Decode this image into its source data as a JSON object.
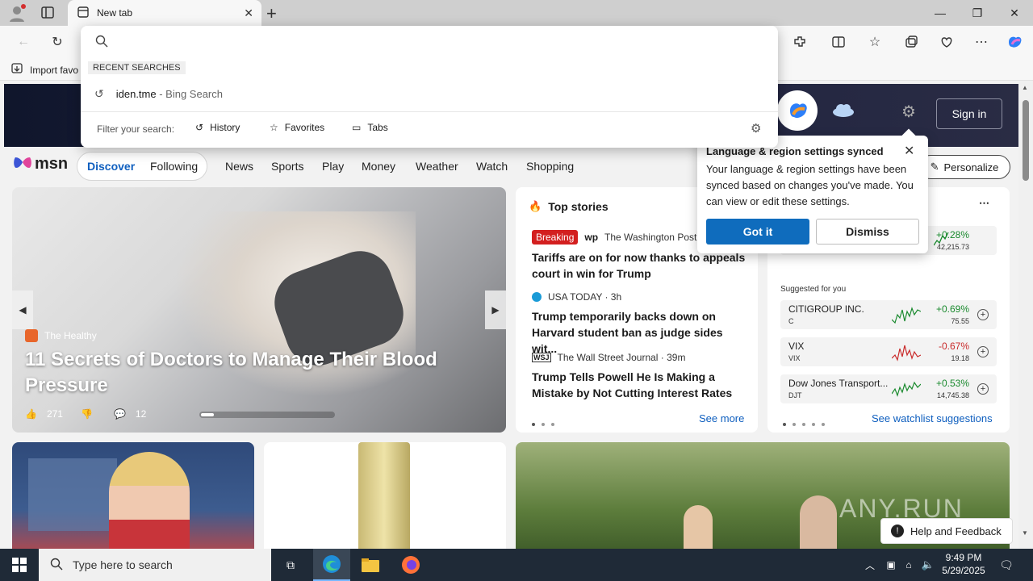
{
  "browser": {
    "tab_title": "New tab",
    "favorites_bar": {
      "import_label": "Import favo"
    }
  },
  "address_dropdown": {
    "input_value": "",
    "recent_heading": "RECENT SEARCHES",
    "recent": [
      {
        "query": "iden.tme",
        "suffix": "- Bing Search"
      }
    ],
    "filter_label": "Filter your search:",
    "filters": [
      "History",
      "Favorites",
      "Tabs"
    ]
  },
  "msn": {
    "logo": "msn",
    "sign_in": "Sign in",
    "nav": {
      "discover": "Discover",
      "following": "Following",
      "items": [
        "News",
        "Sports",
        "Play",
        "Money",
        "Weather",
        "Watch",
        "Shopping"
      ]
    },
    "personalize": "Personalize",
    "hero": {
      "source": "The Healthy",
      "title": "11 Secrets of Doctors to Manage Their Blood Pressure",
      "likes": "271",
      "comments": "12"
    },
    "top_stories": {
      "heading": "Top stories",
      "stories": [
        {
          "badge": "Breaking",
          "source": "The Washington Post ·",
          "headline": "Tariffs are on for now thanks to appeals court in win for Trump"
        },
        {
          "source": "USA TODAY · 3h",
          "headline": "Trump temporarily backs down on Harvard student ban as judge sides wit..."
        },
        {
          "source": "The Wall Street Journal · 39m",
          "headline": "Trump Tells Powell He Is Making a Mistake by Not Cutting Interest Rates"
        }
      ],
      "see_more": "See more"
    },
    "watchlist": {
      "top_row": {
        "pct": "+0.28%",
        "value": "42,215.73"
      },
      "suggested_label": "Suggested for you",
      "stocks": [
        {
          "name": "CITIGROUP INC.",
          "symbol": "C",
          "pct": "+0.69%",
          "value": "75.55",
          "color": "#1a8a2e"
        },
        {
          "name": "VIX",
          "symbol": "VIX",
          "pct": "-0.67%",
          "value": "19.18",
          "color": "#c92a2a"
        },
        {
          "name": "Dow Jones Transport...",
          "symbol": "DJT",
          "pct": "+0.53%",
          "value": "14,745.38",
          "color": "#1a8a2e"
        }
      ],
      "see_suggestions": "See watchlist suggestions"
    },
    "help": "Help and Feedback"
  },
  "popup": {
    "title": "Language & region settings synced",
    "body": "Your language & region settings have been synced based on changes you've made. You can view or edit these settings.",
    "primary": "Got it",
    "secondary": "Dismiss"
  },
  "watermark": "ANY.RUN",
  "taskbar": {
    "search_placeholder": "Type here to search",
    "time": "9:49 PM",
    "date": "5/29/2025"
  }
}
